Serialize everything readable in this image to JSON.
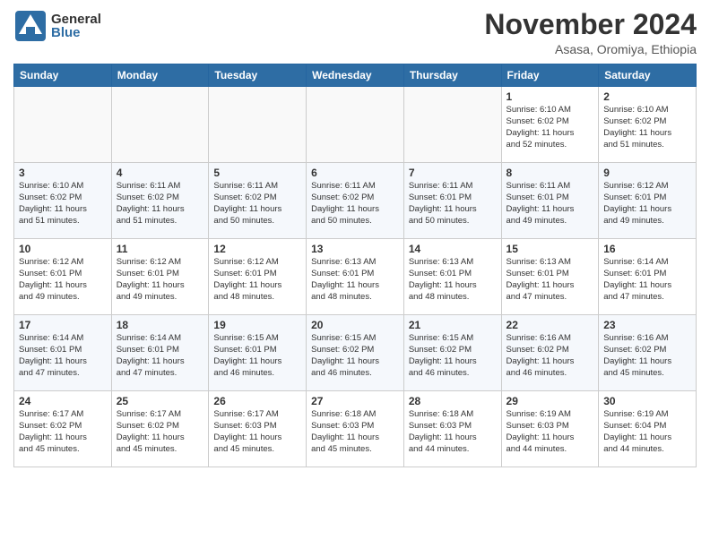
{
  "header": {
    "logo_general": "General",
    "logo_blue": "Blue",
    "month_title": "November 2024",
    "location": "Asasa, Oromiya, Ethiopia"
  },
  "calendar": {
    "days_of_week": [
      "Sunday",
      "Monday",
      "Tuesday",
      "Wednesday",
      "Thursday",
      "Friday",
      "Saturday"
    ],
    "weeks": [
      [
        {
          "day": "",
          "info": ""
        },
        {
          "day": "",
          "info": ""
        },
        {
          "day": "",
          "info": ""
        },
        {
          "day": "",
          "info": ""
        },
        {
          "day": "",
          "info": ""
        },
        {
          "day": "1",
          "info": "Sunrise: 6:10 AM\nSunset: 6:02 PM\nDaylight: 11 hours\nand 52 minutes."
        },
        {
          "day": "2",
          "info": "Sunrise: 6:10 AM\nSunset: 6:02 PM\nDaylight: 11 hours\nand 51 minutes."
        }
      ],
      [
        {
          "day": "3",
          "info": "Sunrise: 6:10 AM\nSunset: 6:02 PM\nDaylight: 11 hours\nand 51 minutes."
        },
        {
          "day": "4",
          "info": "Sunrise: 6:11 AM\nSunset: 6:02 PM\nDaylight: 11 hours\nand 51 minutes."
        },
        {
          "day": "5",
          "info": "Sunrise: 6:11 AM\nSunset: 6:02 PM\nDaylight: 11 hours\nand 50 minutes."
        },
        {
          "day": "6",
          "info": "Sunrise: 6:11 AM\nSunset: 6:02 PM\nDaylight: 11 hours\nand 50 minutes."
        },
        {
          "day": "7",
          "info": "Sunrise: 6:11 AM\nSunset: 6:01 PM\nDaylight: 11 hours\nand 50 minutes."
        },
        {
          "day": "8",
          "info": "Sunrise: 6:11 AM\nSunset: 6:01 PM\nDaylight: 11 hours\nand 49 minutes."
        },
        {
          "day": "9",
          "info": "Sunrise: 6:12 AM\nSunset: 6:01 PM\nDaylight: 11 hours\nand 49 minutes."
        }
      ],
      [
        {
          "day": "10",
          "info": "Sunrise: 6:12 AM\nSunset: 6:01 PM\nDaylight: 11 hours\nand 49 minutes."
        },
        {
          "day": "11",
          "info": "Sunrise: 6:12 AM\nSunset: 6:01 PM\nDaylight: 11 hours\nand 49 minutes."
        },
        {
          "day": "12",
          "info": "Sunrise: 6:12 AM\nSunset: 6:01 PM\nDaylight: 11 hours\nand 48 minutes."
        },
        {
          "day": "13",
          "info": "Sunrise: 6:13 AM\nSunset: 6:01 PM\nDaylight: 11 hours\nand 48 minutes."
        },
        {
          "day": "14",
          "info": "Sunrise: 6:13 AM\nSunset: 6:01 PM\nDaylight: 11 hours\nand 48 minutes."
        },
        {
          "day": "15",
          "info": "Sunrise: 6:13 AM\nSunset: 6:01 PM\nDaylight: 11 hours\nand 47 minutes."
        },
        {
          "day": "16",
          "info": "Sunrise: 6:14 AM\nSunset: 6:01 PM\nDaylight: 11 hours\nand 47 minutes."
        }
      ],
      [
        {
          "day": "17",
          "info": "Sunrise: 6:14 AM\nSunset: 6:01 PM\nDaylight: 11 hours\nand 47 minutes."
        },
        {
          "day": "18",
          "info": "Sunrise: 6:14 AM\nSunset: 6:01 PM\nDaylight: 11 hours\nand 47 minutes."
        },
        {
          "day": "19",
          "info": "Sunrise: 6:15 AM\nSunset: 6:01 PM\nDaylight: 11 hours\nand 46 minutes."
        },
        {
          "day": "20",
          "info": "Sunrise: 6:15 AM\nSunset: 6:02 PM\nDaylight: 11 hours\nand 46 minutes."
        },
        {
          "day": "21",
          "info": "Sunrise: 6:15 AM\nSunset: 6:02 PM\nDaylight: 11 hours\nand 46 minutes."
        },
        {
          "day": "22",
          "info": "Sunrise: 6:16 AM\nSunset: 6:02 PM\nDaylight: 11 hours\nand 46 minutes."
        },
        {
          "day": "23",
          "info": "Sunrise: 6:16 AM\nSunset: 6:02 PM\nDaylight: 11 hours\nand 45 minutes."
        }
      ],
      [
        {
          "day": "24",
          "info": "Sunrise: 6:17 AM\nSunset: 6:02 PM\nDaylight: 11 hours\nand 45 minutes."
        },
        {
          "day": "25",
          "info": "Sunrise: 6:17 AM\nSunset: 6:02 PM\nDaylight: 11 hours\nand 45 minutes."
        },
        {
          "day": "26",
          "info": "Sunrise: 6:17 AM\nSunset: 6:03 PM\nDaylight: 11 hours\nand 45 minutes."
        },
        {
          "day": "27",
          "info": "Sunrise: 6:18 AM\nSunset: 6:03 PM\nDaylight: 11 hours\nand 45 minutes."
        },
        {
          "day": "28",
          "info": "Sunrise: 6:18 AM\nSunset: 6:03 PM\nDaylight: 11 hours\nand 44 minutes."
        },
        {
          "day": "29",
          "info": "Sunrise: 6:19 AM\nSunset: 6:03 PM\nDaylight: 11 hours\nand 44 minutes."
        },
        {
          "day": "30",
          "info": "Sunrise: 6:19 AM\nSunset: 6:04 PM\nDaylight: 11 hours\nand 44 minutes."
        }
      ]
    ]
  }
}
